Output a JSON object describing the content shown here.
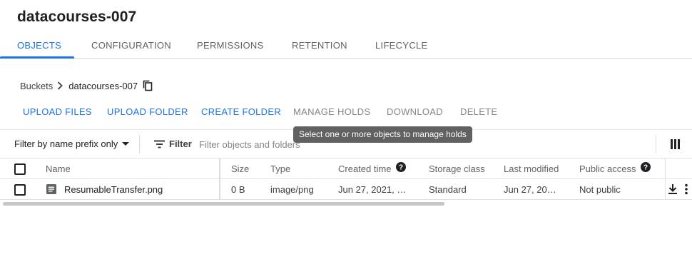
{
  "header": {
    "title": "datacourses-007"
  },
  "tabs": [
    {
      "label": "OBJECTS",
      "active": true
    },
    {
      "label": "CONFIGURATION"
    },
    {
      "label": "PERMISSIONS"
    },
    {
      "label": "RETENTION"
    },
    {
      "label": "LIFECYCLE"
    }
  ],
  "breadcrumb": {
    "root": "Buckets",
    "current": "datacourses-007"
  },
  "actions": {
    "upload_files": "UPLOAD FILES",
    "upload_folder": "UPLOAD FOLDER",
    "create_folder": "CREATE FOLDER",
    "manage_holds": "MANAGE HOLDS",
    "download": "DOWNLOAD",
    "delete": "DELETE"
  },
  "tooltip": "Select one or more objects to manage holds",
  "filter": {
    "prefix_select": "Filter by name prefix only",
    "button_label": "Filter",
    "placeholder": "Filter objects and folders"
  },
  "table": {
    "columns": {
      "name": "Name",
      "size": "Size",
      "type": "Type",
      "created": "Created time",
      "storage": "Storage class",
      "modified": "Last modified",
      "access": "Public access"
    },
    "rows": [
      {
        "name": "ResumableTransfer.png",
        "size": "0 B",
        "type": "image/png",
        "created": "Jun 27, 2021, …",
        "storage": "Standard",
        "modified": "Jun 27, 20…",
        "access": "Not public"
      }
    ]
  },
  "colors": {
    "accent": "#1a73e8",
    "disabled_text": "#80868b",
    "tooltip_bg": "#616161"
  },
  "icons": [
    "chevron-right-icon",
    "copy-icon",
    "dropdown-caret-icon",
    "filter-icon",
    "columns-icon",
    "help-icon",
    "file-icon",
    "download-icon",
    "more-vert-icon"
  ]
}
